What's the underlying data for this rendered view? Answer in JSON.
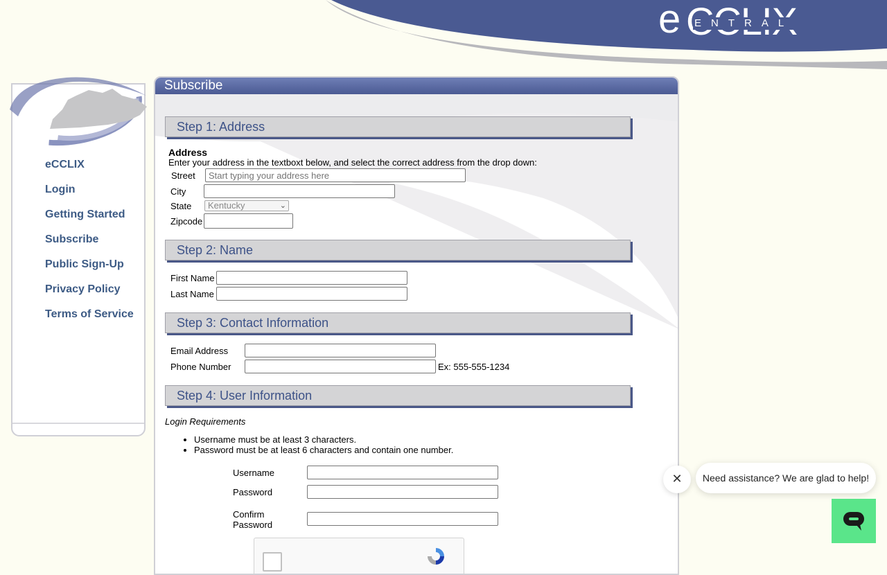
{
  "header": {
    "logo_e": "e",
    "logo_cclix": "CCLIX",
    "logo_central": "ENTRAL"
  },
  "sidebar": {
    "items": [
      {
        "label": "eCCLIX"
      },
      {
        "label": "Login"
      },
      {
        "label": "Getting Started"
      },
      {
        "label": "Subscribe"
      },
      {
        "label": "Public Sign-Up"
      },
      {
        "label": "Privacy Policy"
      },
      {
        "label": "Terms of Service"
      }
    ]
  },
  "panel": {
    "title": "Subscribe"
  },
  "step1": {
    "heading": "Step 1: Address",
    "section_label": "Address",
    "instructions": "Enter your address in the textboxt below, and select the correct address from the drop down:",
    "street_label": "Street",
    "street_placeholder": "Start typing your address here",
    "city_label": "City",
    "state_label": "State",
    "state_value": "Kentucky",
    "zipcode_label": "Zipcode"
  },
  "step2": {
    "heading": "Step 2: Name",
    "first_name_label": "First Name",
    "last_name_label": "Last Name"
  },
  "step3": {
    "heading": "Step 3: Contact Information",
    "email_label": "Email Address",
    "phone_label": "Phone Number",
    "phone_example": "Ex: 555-555-1234"
  },
  "step4": {
    "heading": "Step 4: User Information",
    "requirements_title": "Login Requirements",
    "requirements": [
      "Username must be at least 3 characters.",
      "Password must be at least 6 characters and contain one number."
    ],
    "username_label": "Username",
    "password_label": "Password",
    "confirm_label_line1": "Confirm",
    "confirm_label_line2": "Password"
  },
  "chat": {
    "message": "Need assistance? We are glad to help!",
    "close_glyph": "✕"
  },
  "colors": {
    "header_blue": "#4a5a92",
    "nav_text": "#3d5b85",
    "step_text": "#3d5288",
    "chat_green": "#5ae58a",
    "page_bg": "#fdfdf2"
  }
}
